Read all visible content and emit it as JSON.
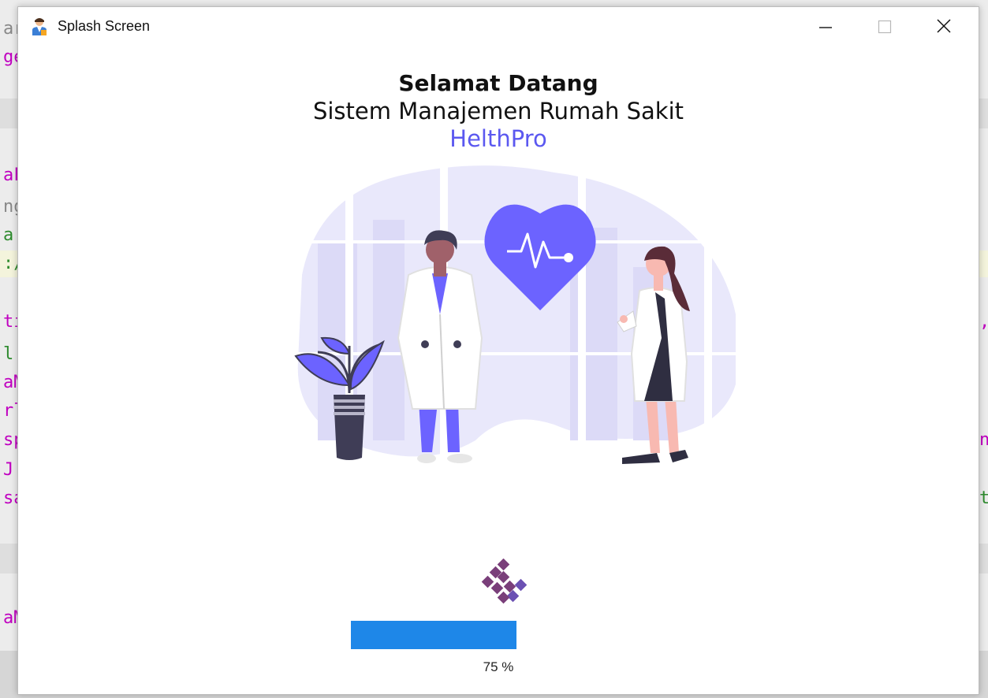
{
  "window": {
    "title": "Splash Screen",
    "icons": {
      "app": "doctor-app-icon",
      "minimize": "minimize-icon",
      "maximize": "maximize-icon",
      "close": "close-icon"
    }
  },
  "headline": {
    "welcome": "Selamat Datang",
    "system": "Sistem Manajemen Rumah Sakit",
    "brand": "HelthPro"
  },
  "progress": {
    "value": 75,
    "label": "75 %",
    "color": "#1e87e8"
  },
  "colors": {
    "brand": "#5b58f0",
    "spinner": "#7a3f7a"
  },
  "background_code": {
    "left": [
      "ar",
      "ge",
      "aF",
      "ng",
      "a",
      ":/",
      "ti",
      "l.",
      "aM",
      "rl",
      "sp",
      "J",
      "sa",
      "aM"
    ],
    "right": [
      ",",
      "n",
      "t"
    ]
  }
}
